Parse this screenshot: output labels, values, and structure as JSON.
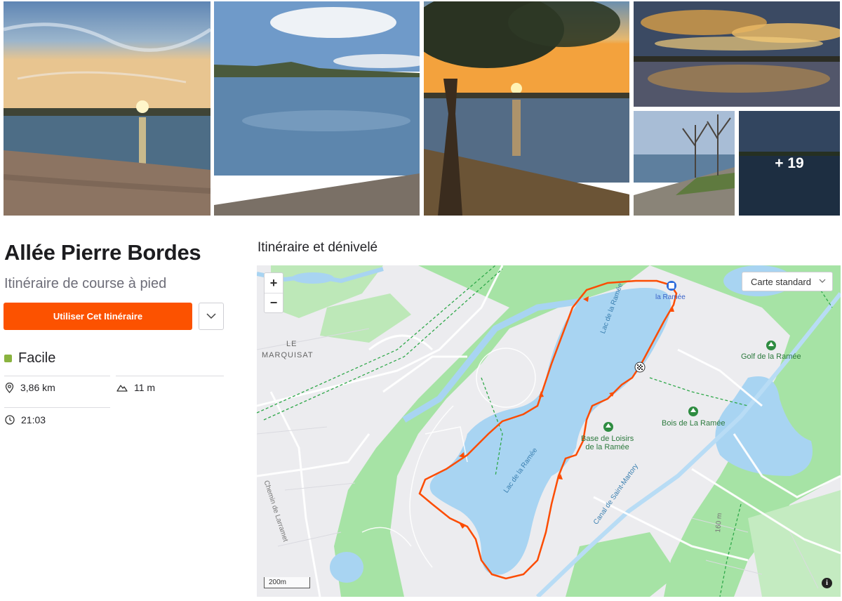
{
  "gallery": {
    "more_count_label": "+ 19"
  },
  "route": {
    "title": "Allée Pierre Bordes",
    "subtitle": "Itinéraire de course à pied",
    "use_button_label": "Utiliser Cet Itinéraire",
    "difficulty": "Facile",
    "difficulty_color": "#8ab33f",
    "stats": {
      "distance": "3,86 km",
      "elevation": "11 m",
      "time": "21:03"
    }
  },
  "map": {
    "heading": "Itinéraire et dénivelé",
    "map_type_label": "Carte standard",
    "zoom_in_label": "+",
    "zoom_out_label": "−",
    "scale_label": "200m",
    "info_label": "i",
    "labels": {
      "le": "LE",
      "marquisat": "MARQUISAT",
      "start": "la Ramée",
      "golf": "Golf de la Ramée",
      "bois": "Bois de La Ramée",
      "base_line1": "Base de Loisirs",
      "base_line2": "de la Ramée",
      "lake_north": "Lac de la Ramée",
      "lake_south": "Lac de la Ramée",
      "canal": "Canal de Saint-Martory",
      "chemin": "Chemin de Larramet",
      "contour": "160 m"
    },
    "route_color": "#fc4c02",
    "water_color": "#a8d4f2",
    "park_color": "#a6e3a5"
  }
}
